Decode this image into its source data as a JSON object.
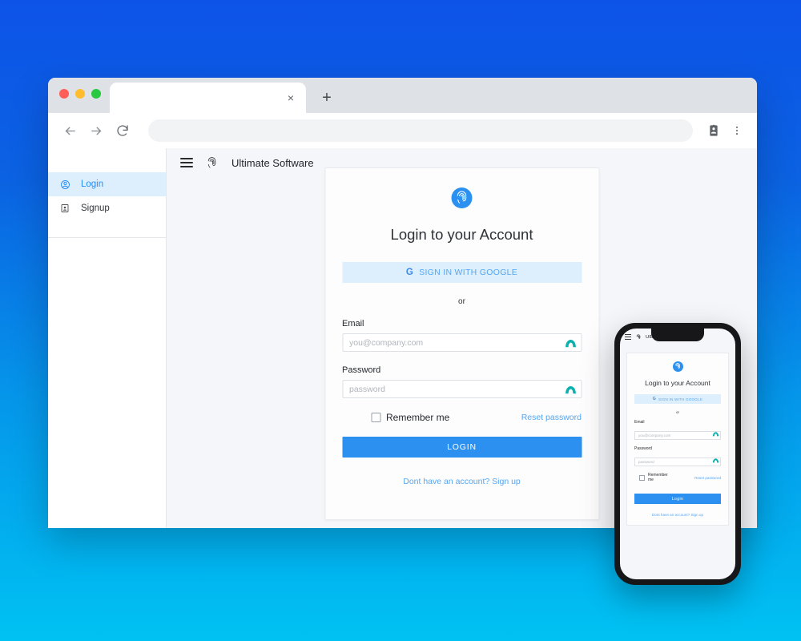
{
  "browser": {
    "tab": {
      "title": "",
      "close_label": "×"
    },
    "new_tab_label": "+",
    "url": "",
    "url_placeholder": "",
    "nav": {
      "back": "back-arrow",
      "forward": "forward-arrow",
      "reload": "reload-icon"
    },
    "profile_icon": "profile-card-icon",
    "menu_icon": "three-dot-menu-icon"
  },
  "app": {
    "brand": "Ultimate Software",
    "menu_icon": "hamburger-menu-icon",
    "brand_icon": "fingerprint-icon",
    "sidebar": {
      "items": [
        {
          "label": "Login",
          "icon": "account-circle-icon",
          "active": true
        },
        {
          "label": "Signup",
          "icon": "badge-icon",
          "active": false
        }
      ]
    }
  },
  "login_card": {
    "logo_icon": "fingerprint-logo-icon",
    "title": "Login to your Account",
    "google_button": {
      "letter": "G",
      "label": "SIGN IN WITH GOOGLE"
    },
    "divider_text": "or",
    "email": {
      "label": "Email",
      "value": "",
      "placeholder": "you@company.com",
      "manager_icon": "password-manager-icon"
    },
    "password": {
      "label": "Password",
      "value": "",
      "placeholder": "password",
      "manager_icon": "password-manager-icon"
    },
    "remember_me": {
      "label": "Remember me",
      "checked": false
    },
    "reset_password": "Reset password",
    "login_button": "LOGIN",
    "signup_prompt": "Dont have an account? Sign up"
  },
  "phone": {
    "brand": "Ultimate Software",
    "title": "Login to your Account",
    "google_letter": "G",
    "google_label": "SIGN IN WITH GOOGLE",
    "divider_text": "or",
    "email_label": "Email",
    "email_placeholder": "you@company.com",
    "email_value": "",
    "password_label": "Password",
    "password_placeholder": "password",
    "password_value": "",
    "remember_me": "Remember me",
    "reset_password": "Reset password",
    "login_button": "Login",
    "signup_prompt": "Dont have an account? Sign up"
  },
  "colors": {
    "brand_blue": "#2b90ef",
    "link_blue": "#54a6f0",
    "google_bg": "#ddeffc",
    "sidebar_active_bg": "#ddeefc",
    "password_manager_teal": "#09b2ae",
    "bg_gradient_top": "#0d53e8",
    "bg_gradient_bottom": "#00c2f2"
  }
}
